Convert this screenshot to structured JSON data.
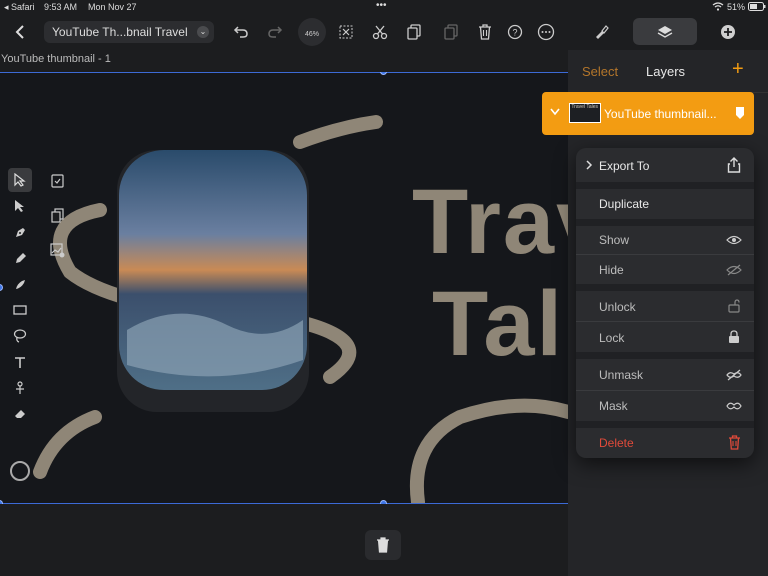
{
  "status_bar": {
    "back_app": "◂ Safari",
    "time": "9:53 AM",
    "date": "Mon Nov 27",
    "battery": "51%",
    "dots": "•••"
  },
  "toolbar": {
    "back_icon": "chevron-left-icon",
    "document_title": "YouTube Th...bnail Travel",
    "zoom": "46%"
  },
  "canvas": {
    "artboard_label": "YouTube thumbnail - 1",
    "headline_line1": "Trav",
    "headline_line2": "Tal"
  },
  "panel": {
    "select_tab": "Select",
    "layers_tab": "Layers",
    "add_label": "+",
    "layer_name": "YouTube thumbnail...",
    "thumb_text": "Travel Tales",
    "accent": "#f39c12"
  },
  "context_menu": {
    "export_to": "Export To",
    "duplicate": "Duplicate",
    "show": "Show",
    "hide": "Hide",
    "unlock": "Unlock",
    "lock": "Lock",
    "unmask": "Unmask",
    "mask": "Mask",
    "delete": "Delete",
    "delete_color": "#e04a3a"
  }
}
